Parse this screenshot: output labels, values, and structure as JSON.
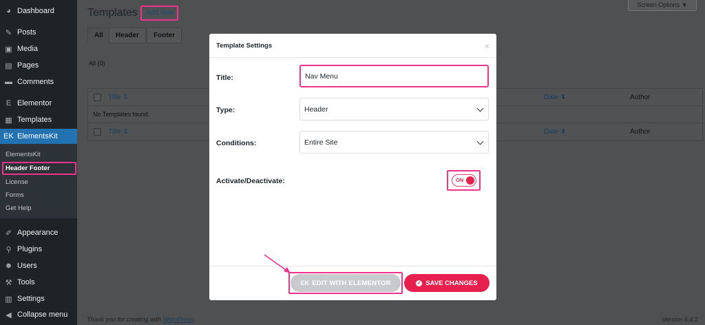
{
  "sidebar": {
    "items": [
      {
        "label": "Dashboard",
        "icon": "dashboard-icon",
        "glyph": "◕"
      },
      {
        "label": "Posts",
        "icon": "pin-icon",
        "glyph": "✎"
      },
      {
        "label": "Media",
        "icon": "media-icon",
        "glyph": "▣"
      },
      {
        "label": "Pages",
        "icon": "pages-icon",
        "glyph": "▤"
      },
      {
        "label": "Comments",
        "icon": "comments-icon",
        "glyph": "▬"
      },
      {
        "label": "Elementor",
        "icon": "elementor-icon",
        "glyph": "E"
      },
      {
        "label": "Templates",
        "icon": "templates-icon",
        "glyph": "▦"
      },
      {
        "label": "ElementsKit",
        "icon": "elementskit-icon",
        "glyph": "EK"
      }
    ],
    "sub_items": [
      "ElementsKit",
      "Header Footer",
      "License",
      "Forms",
      "Get Help"
    ],
    "lower_items": [
      {
        "label": "Appearance",
        "icon": "brush-icon",
        "glyph": "✐"
      },
      {
        "label": "Plugins",
        "icon": "plugin-icon",
        "glyph": "⚲"
      },
      {
        "label": "Users",
        "icon": "user-icon",
        "glyph": "☻"
      },
      {
        "label": "Tools",
        "icon": "wrench-icon",
        "glyph": "⚒"
      },
      {
        "label": "Settings",
        "icon": "settings-icon",
        "glyph": "▥"
      },
      {
        "label": "Collapse menu",
        "icon": "collapse-icon",
        "glyph": "◀"
      }
    ]
  },
  "header": {
    "title": "Templates",
    "add_new": "Add New",
    "screen_options": "Screen Options ▼"
  },
  "tabs": [
    "All",
    "Header",
    "Footer"
  ],
  "filter": "All (0)",
  "table": {
    "columns": {
      "title": "Title ⇕",
      "date": "Date ⬍",
      "author": "Author"
    },
    "empty_message": "No Templates found."
  },
  "footer": {
    "thanks": "Thank you for creating with",
    "link": "WordPress",
    "suffix": ".",
    "version": "Version 6.4.2"
  },
  "modal": {
    "title": "Template Settings",
    "close": "×",
    "fields": {
      "title_label": "Title:",
      "title_value": "Nav Menu",
      "type_label": "Type:",
      "type_value": "Header",
      "conditions_label": "Conditions:",
      "conditions_value": "Entire Site",
      "activate_label": "Activate/Deactivate:",
      "toggle_state": "ON"
    },
    "buttons": {
      "edit": "EDIT WITH ELEMENTOR",
      "save": "SAVE CHANGES"
    }
  },
  "colors": {
    "accent": "#e8204d",
    "highlight": "#f0328c",
    "wp_blue": "#2271b1"
  }
}
